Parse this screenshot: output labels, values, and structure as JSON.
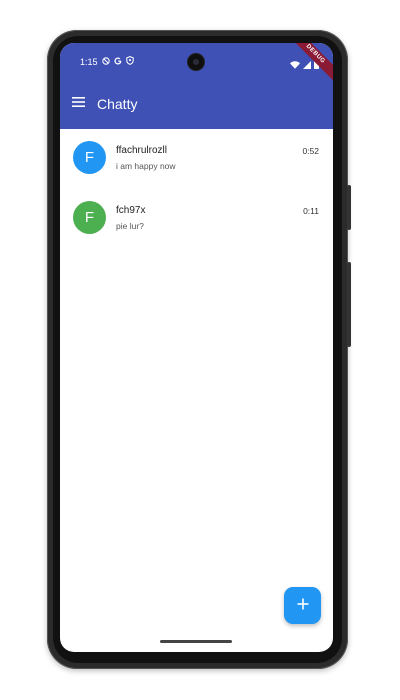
{
  "status_bar": {
    "time": "1:15",
    "debug_label": "DEBUG"
  },
  "app_bar": {
    "title": "Chatty",
    "color": "#3f51b5"
  },
  "chats": [
    {
      "avatar_letter": "F",
      "avatar_color": "#2196f3",
      "name": "ffachrulrozll",
      "last_message": "i am happy now",
      "time": "0:52"
    },
    {
      "avatar_letter": "F",
      "avatar_color": "#4caf50",
      "name": "fch97x",
      "last_message": "pie lur?",
      "time": "0:11"
    }
  ],
  "fab": {
    "icon": "plus-icon",
    "color": "#2196f3"
  }
}
